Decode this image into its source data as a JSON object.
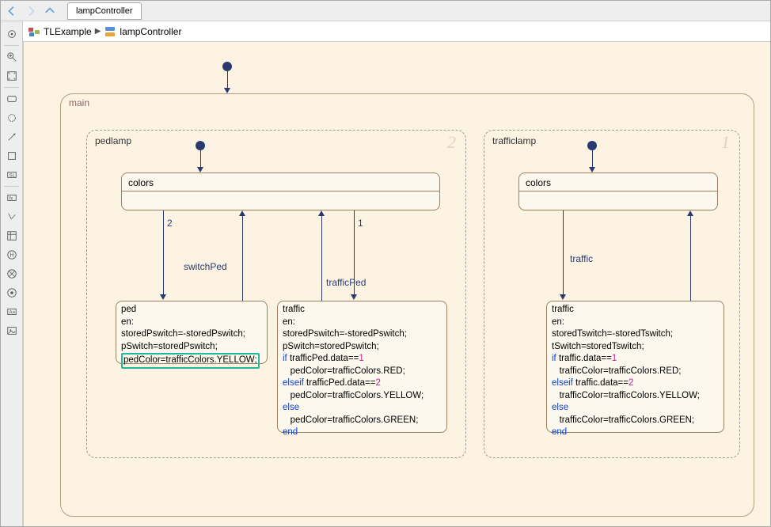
{
  "tab_title": "lampController",
  "breadcrumb": {
    "root": "TLExample",
    "current": "lampController"
  },
  "canvas": {
    "main_label": "main",
    "pedlamp": {
      "label": "pedlamp",
      "priority": "2",
      "colors_state": "colors",
      "edge_switchPed": "switchPed",
      "edge_trafficPed": "trafficPed",
      "edge_num_left": "2",
      "edge_num_right": "1",
      "ped_state": {
        "title": "ped",
        "line1": "en:",
        "line2": "storedPswitch=-storedPswitch;",
        "line3": "pSwitch=storedPswitch;",
        "line4": "pedColor=trafficColors.YELLOW;"
      },
      "traffic_state": {
        "title": "traffic",
        "line1": "en:",
        "line2": "storedPswitch=-storedPswitch;",
        "line3": "pSwitch=storedPswitch;",
        "line4_pre": "if",
        "line4_rest": " trafficPed.data==",
        "line4_num": "1",
        "line5": "   pedColor=trafficColors.RED;",
        "line6_pre": "elseif",
        "line6_rest": " trafficPed.data==",
        "line6_num": "2",
        "line7": "   pedColor=trafficColors.YELLOW;",
        "line8": "else",
        "line9": "   pedColor=trafficColors.GREEN;",
        "line10": "end"
      }
    },
    "trafficlamp": {
      "label": "trafficlamp",
      "priority": "1",
      "colors_state": "colors",
      "edge_traffic": "traffic",
      "traffic_state": {
        "title": "traffic",
        "line1": "en:",
        "line2": "storedTswitch=-storedTswitch;",
        "line3": "tSwitch=storedTswitch;",
        "line4_pre": "if",
        "line4_rest": " traffic.data==",
        "line4_num": "1",
        "line5": "   trafficColor=trafficColors.RED;",
        "line6_pre": "elseif",
        "line6_rest": " traffic.data==",
        "line6_num": "2",
        "line7": "   trafficColor=trafficColors.YELLOW;",
        "line8_pre": "else",
        "line9": "   trafficColor=trafficColors.GREEN;",
        "line10": "end"
      }
    }
  }
}
